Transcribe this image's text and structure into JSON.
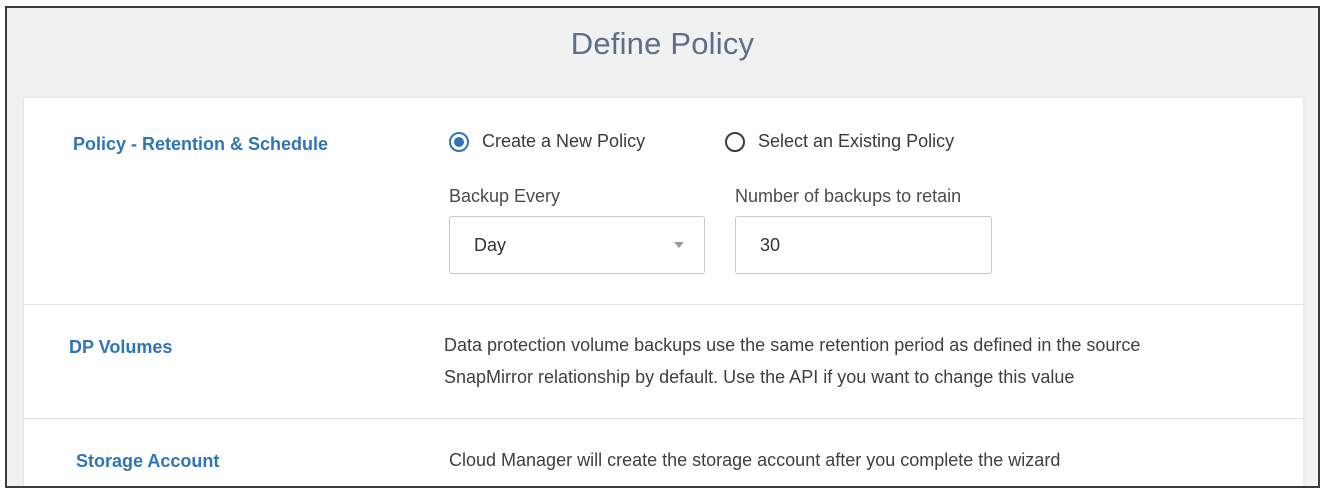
{
  "page": {
    "title": "Define Policy"
  },
  "policy_section": {
    "label": "Policy  - Retention & Schedule",
    "radio_new": {
      "label": "Create a New Policy",
      "checked": true
    },
    "radio_existing": {
      "label": "Select an Existing Policy",
      "checked": false
    },
    "backup_every": {
      "label": "Backup Every",
      "selected": "Day"
    },
    "retain": {
      "label": "Number of backups to retain",
      "value": "30"
    }
  },
  "dp_section": {
    "label": "DP Volumes",
    "line1": "Data protection volume backups use the same retention period as defined in the source",
    "line2": "SnapMirror relationship by default. Use the API if you want to change this value"
  },
  "storage_section": {
    "label": "Storage Account",
    "text": "Cloud Manager will create the storage account after you complete the wizard"
  },
  "colors": {
    "accent": "#2f75b5",
    "title": "#5d6f86",
    "background": "#f1f1f1"
  }
}
